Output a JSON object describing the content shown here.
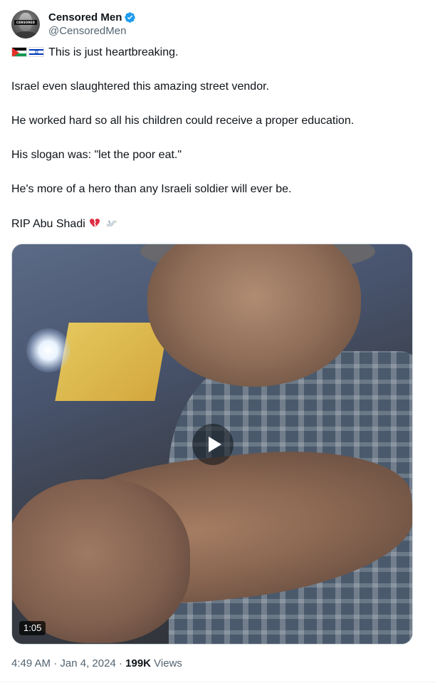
{
  "author": {
    "display_name": "Censored Men",
    "handle": "@CensoredMen",
    "avatar_label": "CENSORED",
    "verified_color": "#1d9bf0"
  },
  "tweet": {
    "line1": "This is just heartbreaking.",
    "line2": "Israel even slaughtered this amazing street vendor.",
    "line3": "He worked hard so all his children could receive a proper education.",
    "line4": "His slogan was: \"let the poor eat.\"",
    "line5": "He's more of a hero than any Israeli soldier will ever be.",
    "line6": "RIP Abu Shadi",
    "flags": [
      "palestine-flag-icon",
      "israel-flag-icon"
    ],
    "end_emojis": [
      "broken-heart-icon",
      "dove-icon"
    ]
  },
  "video": {
    "duration": "1:05"
  },
  "meta": {
    "time": "4:49 AM",
    "sep1": " · ",
    "date": "Jan 4, 2024",
    "sep2": " · ",
    "views_count": "199K",
    "views_label": " Views"
  },
  "colors": {
    "text_primary": "#0f1419",
    "text_secondary": "#536471",
    "accent": "#1d9bf0"
  }
}
